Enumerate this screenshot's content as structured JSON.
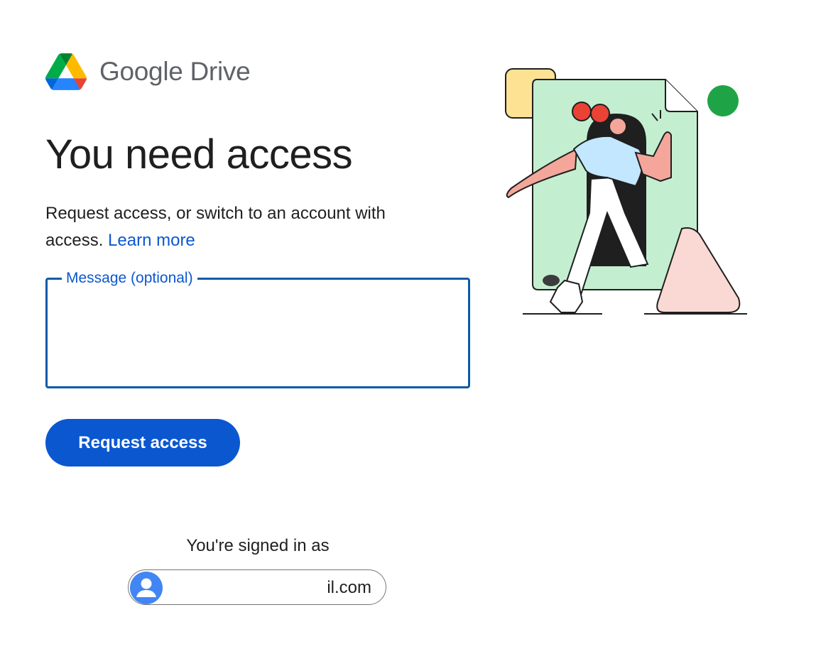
{
  "brand": {
    "google": "Google",
    "product": "Drive",
    "logo_icon": "google-drive-logo-icon"
  },
  "page_title": "You need access",
  "description": {
    "text": "Request access, or switch to an account with access.",
    "learn_more": "Learn more"
  },
  "message_field": {
    "label": "Message (optional)",
    "value": ""
  },
  "request_button": {
    "label": "Request access"
  },
  "account": {
    "signed_in_label": "You're signed in as",
    "email_visible": "il.com",
    "avatar_icon": "person-icon"
  },
  "illustration": {
    "icon": "person-opening-door-illustration"
  },
  "colors": {
    "primary": "#0b57d0",
    "title": "#1f1f1f",
    "brand_gray": "#5f6368",
    "field_border": "#0b5aa8"
  }
}
